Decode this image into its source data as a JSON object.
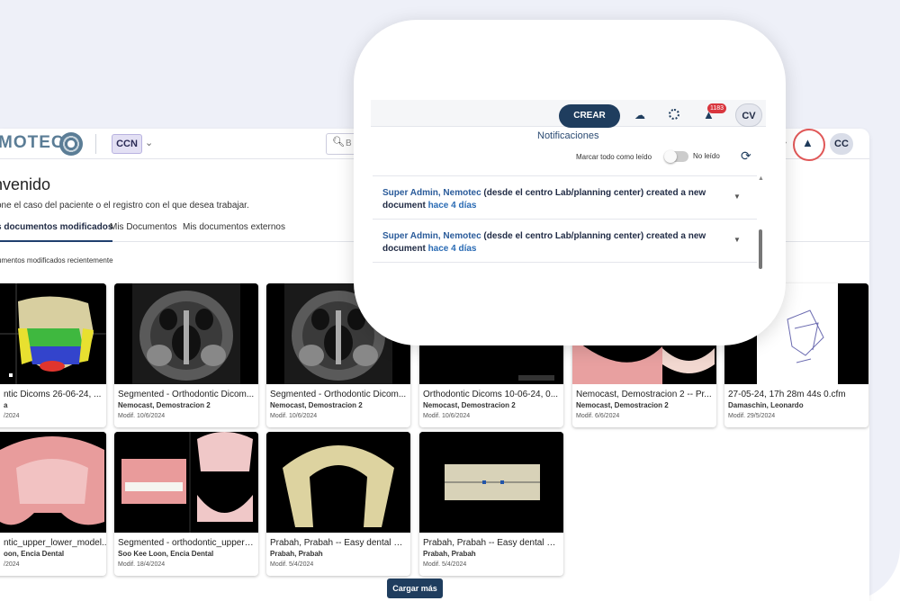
{
  "header": {
    "logo_text": "MOTEC",
    "workspace": "CCN",
    "search_placeholder": "B",
    "avatar": "CC"
  },
  "welcome": {
    "title": "nvenido",
    "subtitle": "one el caso del paciente o el registro con el que desea trabajar."
  },
  "tabs": [
    {
      "label": "s documentos modificados",
      "active": true
    },
    {
      "label": "Mis Documentos",
      "active": false
    },
    {
      "label": "Mis documentos externos",
      "active": false
    }
  ],
  "section_label": "umentos modificados recientemente",
  "cards": [
    {
      "title": "ntic Dicoms 26-06-24, ...",
      "owner": "a",
      "date": "/2024",
      "thumb": "skull-3d"
    },
    {
      "title": "Segmented - Orthodontic Dicom...",
      "owner": "Nemocast, Demostracion 2",
      "date": "Modif. 10/6/2024",
      "thumb": "ct-scan"
    },
    {
      "title": "Segmented - Orthodontic Dicom...",
      "owner": "Nemocast, Demostracion 2",
      "date": "Modif. 10/6/2024",
      "thumb": "ct-scan"
    },
    {
      "title": "Orthodontic Dicoms 10-06-24, 0...",
      "owner": "Nemocast, Demostracion 2",
      "date": "Modif. 10/6/2024",
      "thumb": "black"
    },
    {
      "title": "Nemocast, Demostracion 2 -- Pr...",
      "owner": "Nemocast, Demostracion 2",
      "date": "Modif. 6/6/2024",
      "thumb": "teeth"
    },
    {
      "title": "27-05-24, 17h 28m 44s 0.cfm",
      "owner": "Damaschin, Leonardo",
      "date": "Modif. 29/5/2024",
      "thumb": "ceph"
    },
    {
      "title": "ntic_upper_lower_model...",
      "owner": "oon, Encia Dental",
      "date": "/2024",
      "thumb": "arch-pink"
    },
    {
      "title": "Segmented - orthodontic_upper_...",
      "owner": "Soo Kee Loon, Encia Dental",
      "date": "Modif. 18/4/2024",
      "thumb": "multi-teeth"
    },
    {
      "title": "Prabah, Prabah -- Easy dental Co...",
      "owner": "Prabah, Prabah",
      "date": "Modif. 5/4/2024",
      "thumb": "arch-beige"
    },
    {
      "title": "Prabah, Prabah -- Easy dental Co...",
      "owner": "Prabah, Prabah",
      "date": "Modif. 5/4/2024",
      "thumb": "front-teeth"
    }
  ],
  "load_more": "Cargar más",
  "popup": {
    "crear": "CREAR",
    "badge": "1183",
    "avatar": "CV",
    "title": "Notificaciones",
    "mark_all": "Marcar todo como leído",
    "unread": "No leído",
    "notifications": [
      {
        "who": "Super Admin, Nemotec",
        "rest": " (desde el centro Lab/planning center) created a new document ",
        "when": "hace 4 días"
      },
      {
        "who": "Super Admin, Nemotec",
        "rest": " (desde el centro Lab/planning center) created a new document ",
        "when": "hace 4 días"
      }
    ]
  },
  "colors": {
    "primary": "#1f3d5e",
    "badge": "#d9363e",
    "highlight_ring": "#e05757"
  }
}
